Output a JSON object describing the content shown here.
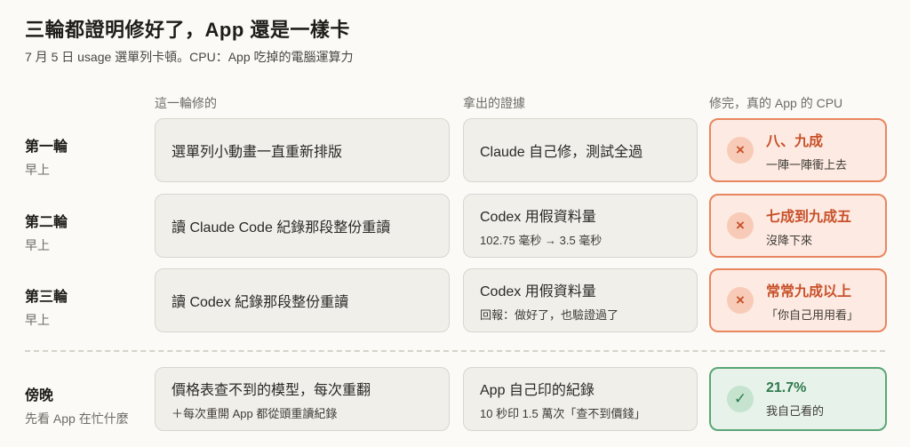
{
  "header": {
    "title": "三輪都證明修好了，App 還是一樣卡",
    "subtitle": "7 月 5 日 usage 選單列卡頓。CPU：App 吃掉的電腦運算力"
  },
  "columns": {
    "fix": "這一輪修的",
    "evidence": "拿出的證據",
    "cpu": "修完，真的 App 的 CPU"
  },
  "rows": [
    {
      "label": "第一輪",
      "time": "早上",
      "fix": "選單列小動畫一直重新排版",
      "fix_detail": "",
      "evidence": "Claude 自己修，測試全過",
      "evidence_detail": "",
      "status": "fail",
      "icon": "×",
      "cpu": "八、九成",
      "cpu_note": "一陣一陣衝上去"
    },
    {
      "label": "第二輪",
      "time": "早上",
      "fix": "讀 Claude Code 紀錄那段整份重讀",
      "fix_detail": "",
      "evidence": "Codex 用假資料量",
      "evidence_detail": "102.75 毫秒 → 3.5 毫秒",
      "status": "fail",
      "icon": "×",
      "cpu": "七成到九成五",
      "cpu_note": "沒降下來"
    },
    {
      "label": "第三輪",
      "time": "早上",
      "fix": "讀 Codex 紀錄那段整份重讀",
      "fix_detail": "",
      "evidence": "Codex 用假資料量",
      "evidence_detail": "回報：做好了，也驗證過了",
      "status": "fail",
      "icon": "×",
      "cpu": "常常九成以上",
      "cpu_note": "「你自己用用看」"
    },
    {
      "label": "傍晚",
      "time": "先看 App 在忙什麼",
      "fix": "價格表查不到的模型，每次重翻",
      "fix_detail": "＋每次重開 App 都從頭重讀紀錄",
      "evidence": "App 自己印的紀錄",
      "evidence_detail": "10 秒印 1.5 萬次「查不到價錢」",
      "status": "pass",
      "icon": "✓",
      "cpu": "21.7%",
      "cpu_note": "我自己看的"
    }
  ],
  "colors": {
    "fail_border": "#e8865f",
    "fail_bg": "#fdeae2",
    "pass_border": "#5aa677",
    "pass_bg": "#e7f3ea"
  }
}
